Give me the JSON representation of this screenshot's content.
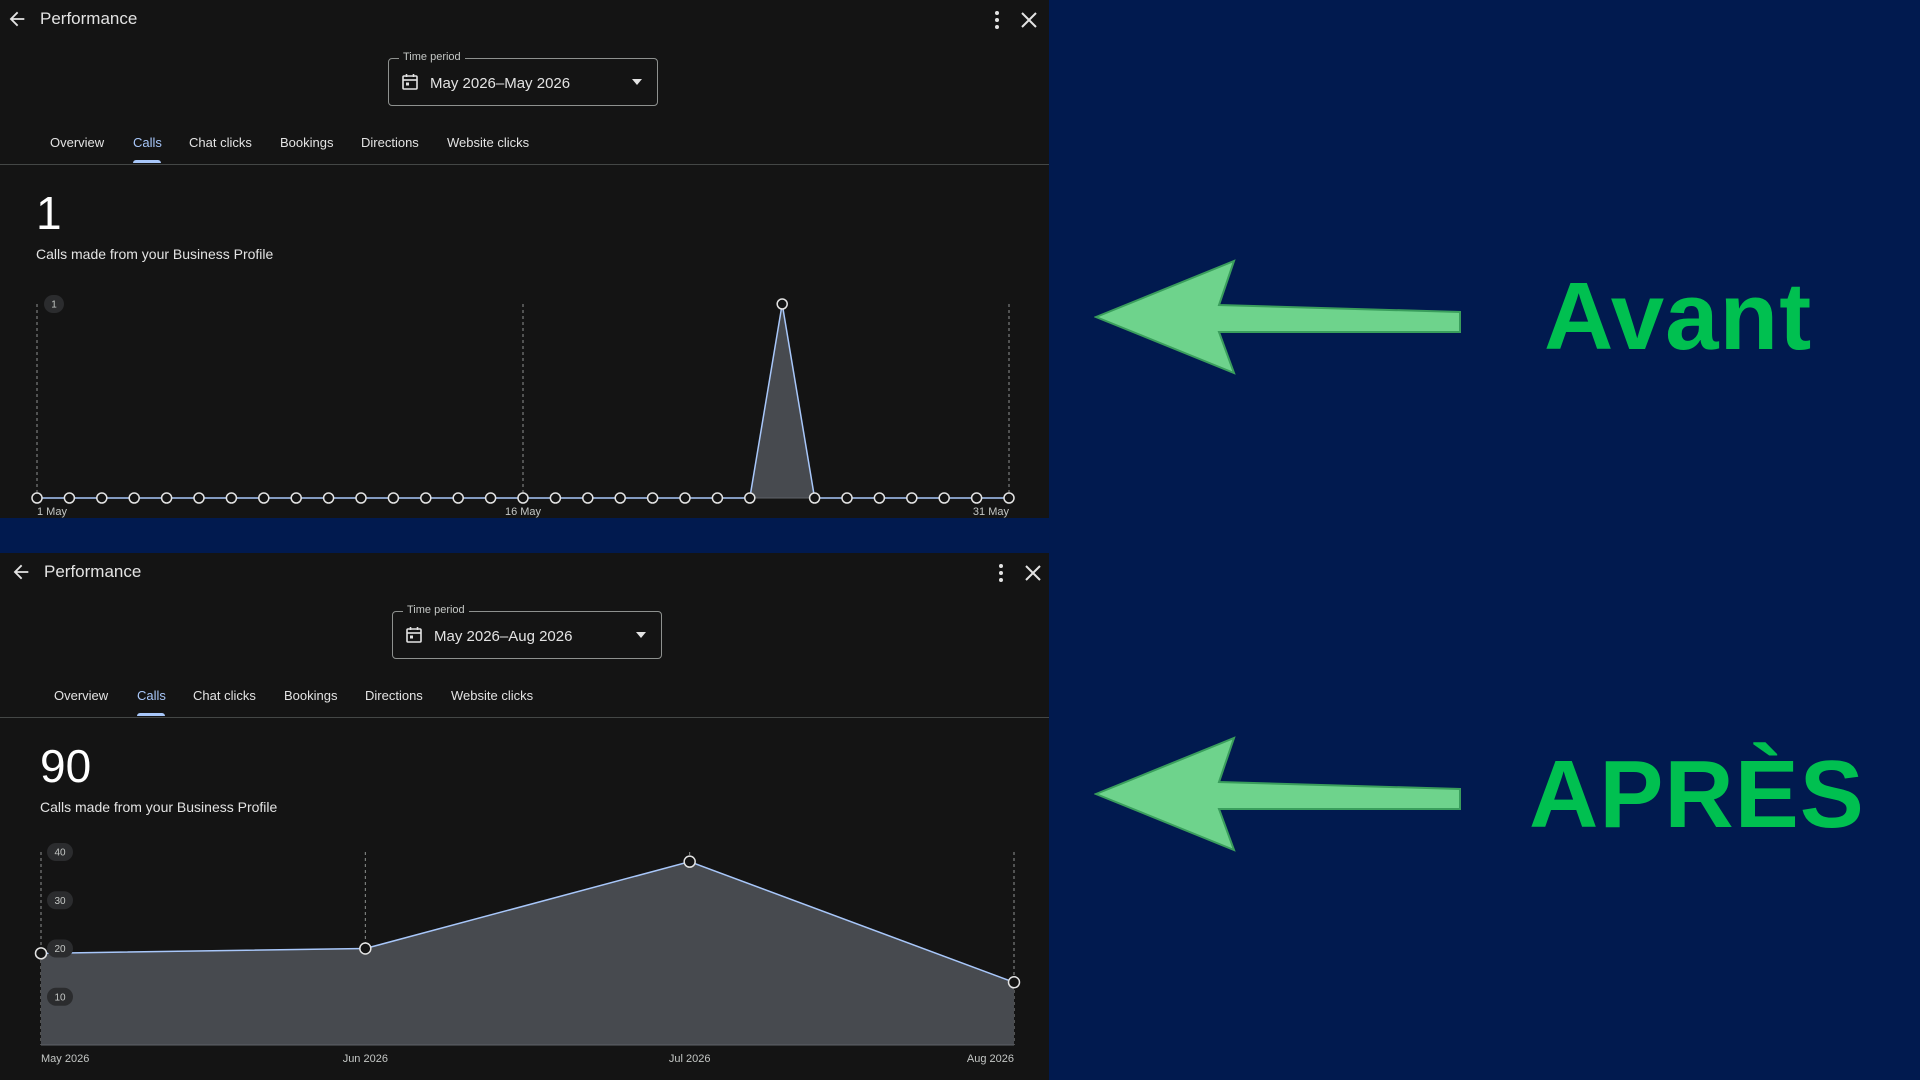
{
  "screens": [
    {
      "title": "Performance",
      "time_period_label": "Time period",
      "time_period_value": "May 2026–May 2026",
      "tabs": [
        {
          "label": "Overview",
          "active": false
        },
        {
          "label": "Calls",
          "active": true
        },
        {
          "label": "Chat clicks",
          "active": false
        },
        {
          "label": "Bookings",
          "active": false
        },
        {
          "label": "Directions",
          "active": false
        },
        {
          "label": "Website clicks",
          "active": false
        }
      ],
      "big_number": "1",
      "subtitle": "Calls made from your Business Profile"
    },
    {
      "title": "Performance",
      "time_period_label": "Time period",
      "time_period_value": "May 2026–Aug 2026",
      "tabs": [
        {
          "label": "Overview",
          "active": false
        },
        {
          "label": "Calls",
          "active": true
        },
        {
          "label": "Chat clicks",
          "active": false
        },
        {
          "label": "Bookings",
          "active": false
        },
        {
          "label": "Directions",
          "active": false
        },
        {
          "label": "Website clicks",
          "active": false
        }
      ],
      "big_number": "90",
      "subtitle": "Calls made from your Business Profile"
    }
  ],
  "annotations": {
    "top_label": "Avant",
    "bottom_label": "APRÈS",
    "arrow_color": "#6ed38c",
    "label_color": "#00c050",
    "background_color": "#011a4f"
  },
  "icons": {
    "back": "arrow-left-icon",
    "more": "more-vert-icon",
    "close": "close-icon",
    "calendar": "calendar-icon",
    "dropdown": "dropdown-triangle-icon"
  },
  "chart_data": [
    {
      "type": "area",
      "x": [
        "1 May",
        "2 May",
        "3 May",
        "4 May",
        "5 May",
        "6 May",
        "7 May",
        "8 May",
        "9 May",
        "10 May",
        "11 May",
        "12 May",
        "13 May",
        "14 May",
        "15 May",
        "16 May",
        "17 May",
        "18 May",
        "19 May",
        "20 May",
        "21 May",
        "22 May",
        "23 May",
        "24 May",
        "25 May",
        "26 May",
        "27 May",
        "28 May",
        "29 May",
        "30 May",
        "31 May"
      ],
      "values": [
        0,
        0,
        0,
        0,
        0,
        0,
        0,
        0,
        0,
        0,
        0,
        0,
        0,
        0,
        0,
        0,
        0,
        0,
        0,
        0,
        0,
        0,
        0,
        1,
        0,
        0,
        0,
        0,
        0,
        0,
        0
      ],
      "xtick_labels": [
        "1 May",
        "16 May",
        "31 May"
      ],
      "xtick_indices": [
        0,
        15,
        30
      ],
      "yticks": [
        1
      ],
      "ylim": [
        0,
        1
      ],
      "line_color": "#a8c7fa",
      "fill_color": "#474a4f"
    },
    {
      "type": "area",
      "x": [
        "May 2026",
        "Jun 2026",
        "Jul 2026",
        "Aug 2026"
      ],
      "values": [
        19,
        20,
        38,
        13
      ],
      "xtick_labels": [
        "May 2026",
        "Jun 2026",
        "Jul 2026",
        "Aug 2026"
      ],
      "xtick_indices": [
        0,
        1,
        2,
        3
      ],
      "yticks": [
        10,
        20,
        30,
        40
      ],
      "ylim": [
        0,
        40
      ],
      "line_color": "#a8c7fa",
      "fill_color": "#474a4f"
    }
  ]
}
